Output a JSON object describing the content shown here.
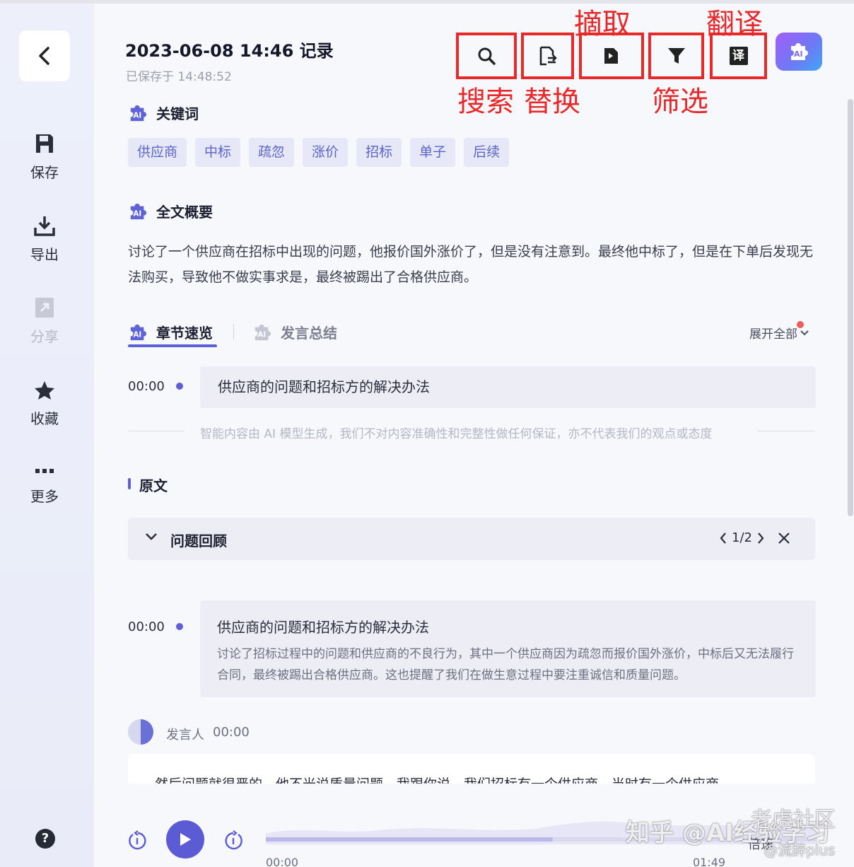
{
  "sidebar": {
    "items": [
      {
        "label": "保存",
        "icon": "save-icon"
      },
      {
        "label": "导出",
        "icon": "download-icon"
      },
      {
        "label": "分享",
        "icon": "share-icon",
        "disabled": true
      },
      {
        "label": "收藏",
        "icon": "star-icon"
      },
      {
        "label": "更多",
        "icon": "more-icon"
      }
    ],
    "help": "?"
  },
  "header": {
    "title": "2023-06-08 14:46 记录",
    "saved": "已保存于 14:48:52"
  },
  "annotations": {
    "search": "搜索",
    "replace": "替换",
    "extract": "摘取",
    "filter": "筛选",
    "translate": "翻译"
  },
  "toolbar": {
    "translate_glyph": "译"
  },
  "keywords": {
    "heading": "关键词",
    "tags": [
      "供应商",
      "中标",
      "疏忽",
      "涨价",
      "招标",
      "单子",
      "后续"
    ]
  },
  "summary": {
    "heading": "全文概要",
    "text": "讨论了一个供应商在招标中出现的问题，他报价国外涨价了，但是没有注意到。最终他中标了，但是在下单后发现无法购买，导致他不做实事求是，最终被踢出了合格供应商。"
  },
  "tabs": {
    "active": "章节速览",
    "inactive": "发言总结",
    "expand": "展开全部"
  },
  "chapter": {
    "time": "00:00",
    "title": "供应商的问题和招标方的解决办法"
  },
  "disclaimer": "智能内容由 AI 模型生成，我们不对内容准确性和完整性做任何保证，亦不代表我们的观点或态度",
  "original": {
    "heading": "原文",
    "search_term": "问题回顾",
    "pager": "1/2",
    "card": {
      "time": "00:00",
      "title": "供应商的问题和招标方的解决办法",
      "body": "讨论了招标过程中的问题和供应商的不良行为，其中一个供应商因为疏忽而报价国外涨价，中标后又无法履行合同，最终被踢出合格供应商。这也提醒了我们在做生意过程中要注重诚信和质量问题。"
    },
    "speaker": "发言人",
    "speaker_time": "00:00",
    "transcript": "然后问题就很严的，他不光说质量问题，我跟你说，我们招标有一个供应商，当时有一个供应商"
  },
  "player": {
    "time_start": "00:00",
    "time_end": "01:49",
    "speed": "倍速",
    "progress": 0.52
  },
  "watermark": {
    "zhihu": "知乎 @AI经验学习",
    "community": "老虎社区",
    "author": "@流辞plus"
  },
  "colors": {
    "accent": "#5d5fd9",
    "annotation": "#e8292a"
  }
}
